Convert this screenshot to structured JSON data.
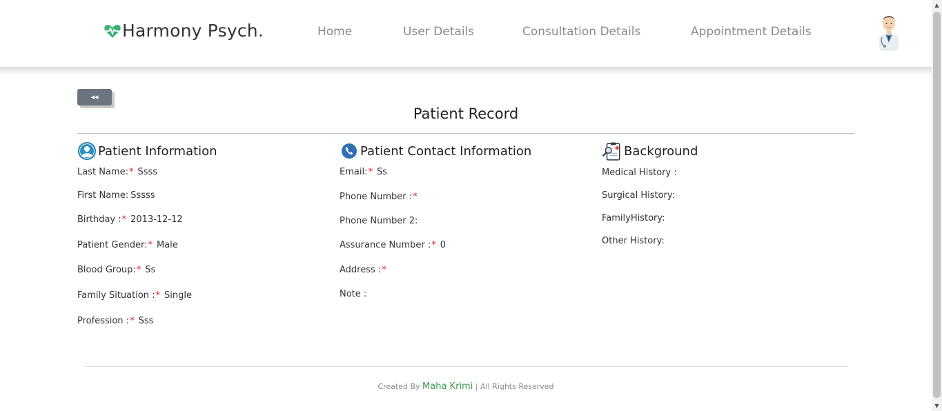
{
  "brand": {
    "name": "Harmony Psych.",
    "logo_icon": "heart-pulse-icon",
    "accent": "#3bb273"
  },
  "nav": {
    "home": "Home",
    "user_details": "User Details",
    "consultation_details": "Consultation Details",
    "appointment_details": "Appointment Details"
  },
  "back_button": {
    "icon": "rewind-icon",
    "label": "◂◂"
  },
  "page_title": "Patient Record",
  "patient_information": {
    "title": "Patient Information",
    "fields": [
      {
        "label": "Last Name:",
        "required": true,
        "value": "Ssss"
      },
      {
        "label": "First Name:",
        "required": false,
        "value": "Sssss"
      },
      {
        "label": "Birthday :",
        "required": true,
        "value": "2013-12-12"
      },
      {
        "label": "Patient Gender:",
        "required": true,
        "value": "Male"
      },
      {
        "label": "Blood Group:",
        "required": true,
        "value": "Ss"
      },
      {
        "label": "Family Situation :",
        "required": true,
        "value": "Single"
      },
      {
        "label": "Profession :",
        "required": true,
        "value": "Sss"
      }
    ]
  },
  "contact_information": {
    "title": "Patient Contact Information",
    "fields": [
      {
        "label": "Email:",
        "required": true,
        "value": "Ss"
      },
      {
        "label": "Phone Number :",
        "required": true,
        "value": ""
      },
      {
        "label": "Phone Number 2:",
        "required": false,
        "value": ""
      },
      {
        "label": "Assurance Number :",
        "required": true,
        "value": "0"
      },
      {
        "label": "Address :",
        "required": true,
        "value": ""
      },
      {
        "label": "Note :",
        "required": false,
        "value": ""
      }
    ]
  },
  "background": {
    "title": "Background",
    "fields": [
      {
        "label": "Medical History :",
        "required": false,
        "value": ""
      },
      {
        "label": "Surgical History:",
        "required": false,
        "value": ""
      },
      {
        "label": "FamilyHistory:",
        "required": false,
        "value": ""
      },
      {
        "label": "Other History:",
        "required": false,
        "value": ""
      }
    ]
  },
  "footer": {
    "prefix": "Created By",
    "author": "Maha Krimi",
    "suffix": "| All Rights Reserved"
  },
  "required_marker": "*",
  "colors": {
    "required": "#d9261c",
    "back_button": "#6c757d",
    "author": "#3a9a4a"
  }
}
